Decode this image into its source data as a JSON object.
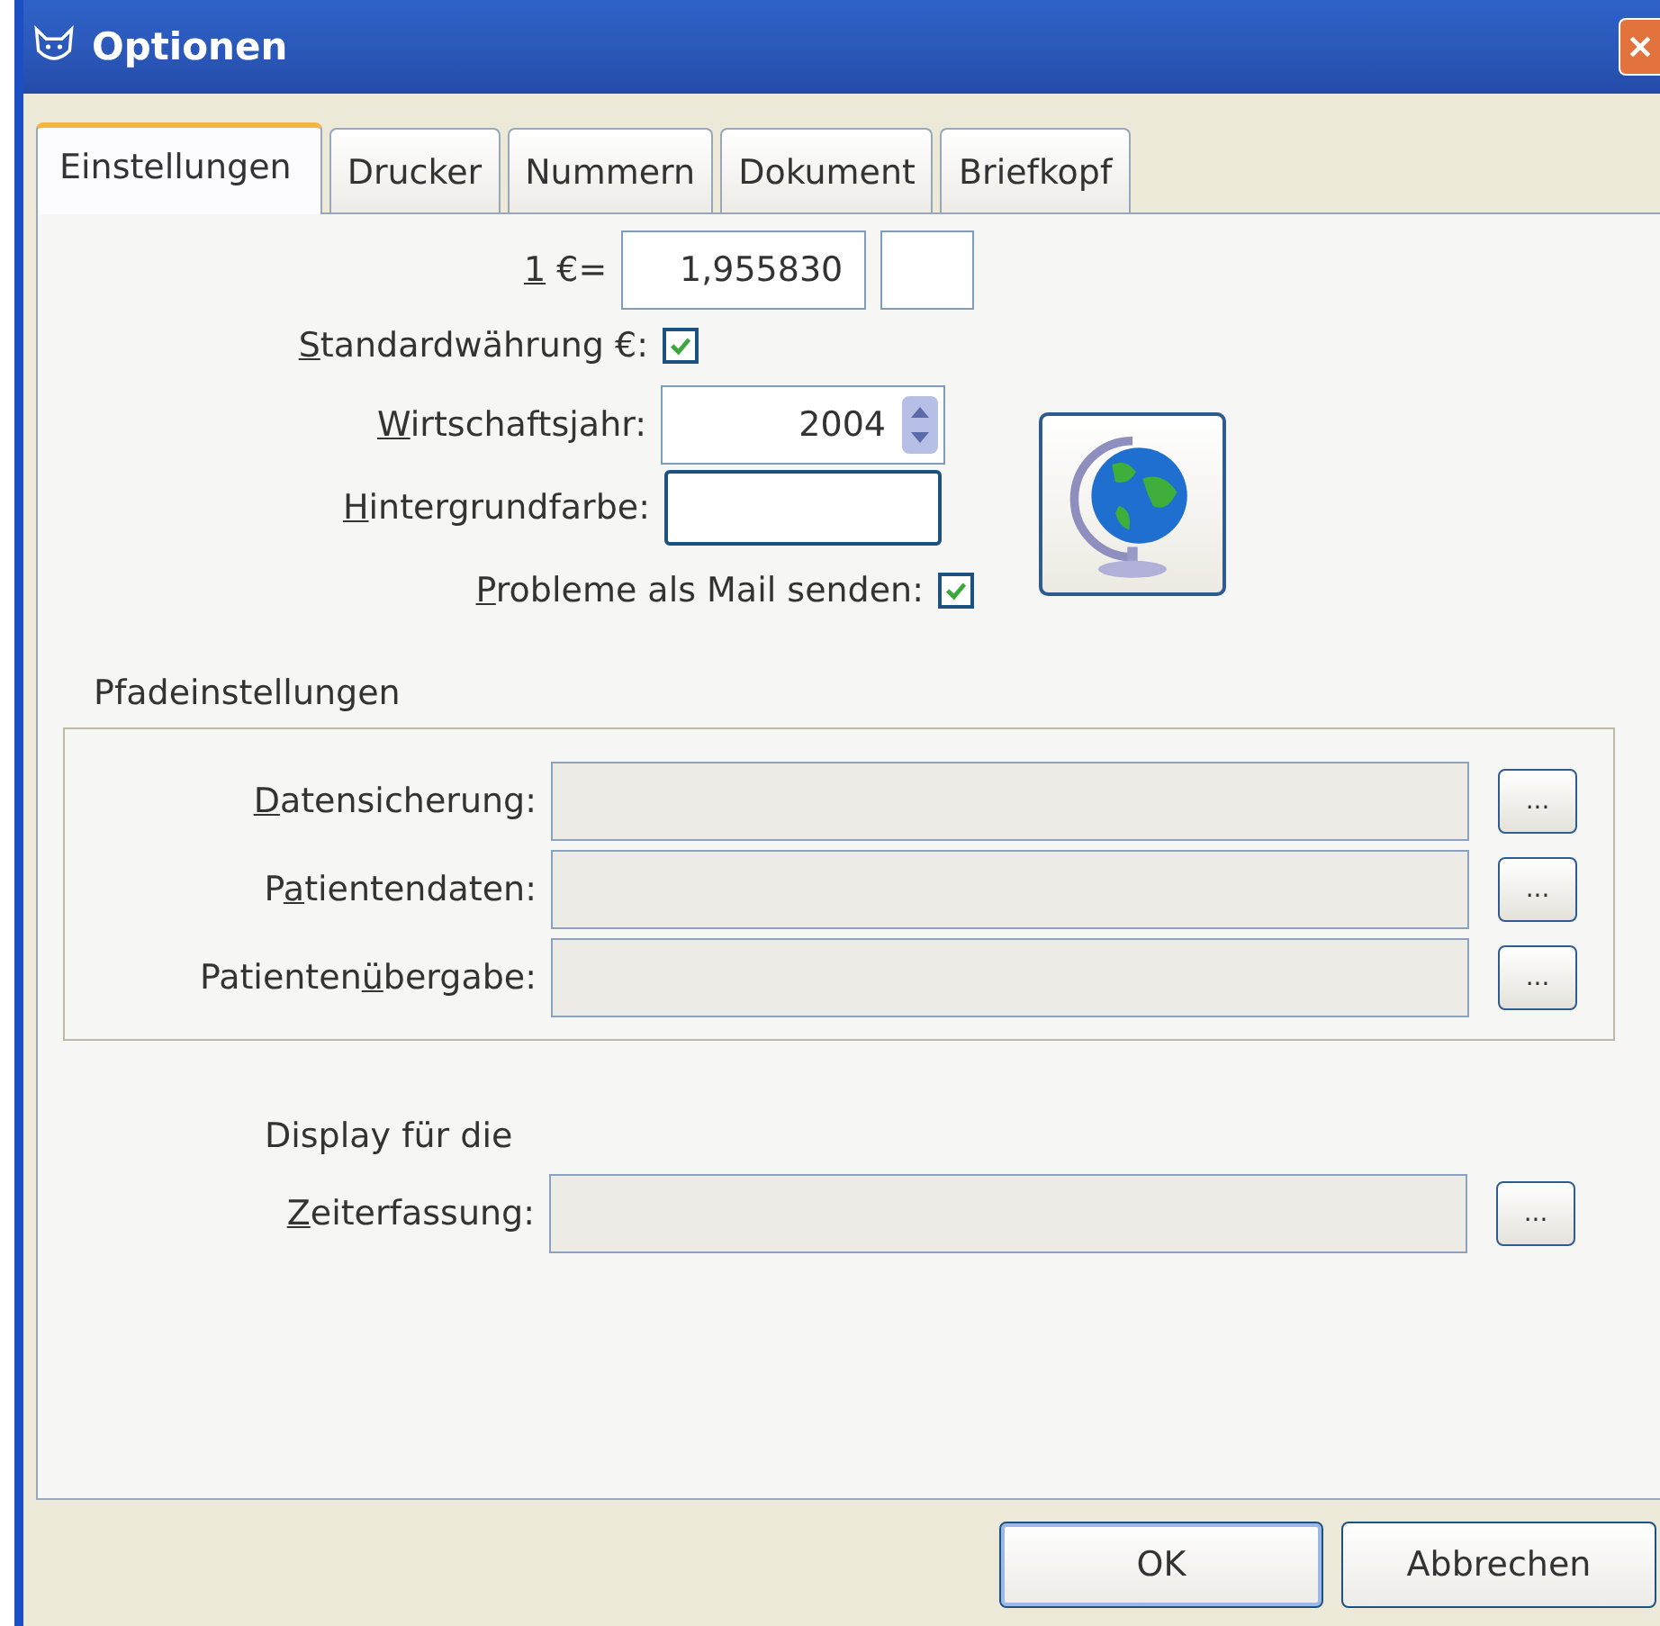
{
  "window": {
    "title": "Optionen"
  },
  "tabs": [
    {
      "label": "Einstellungen",
      "selected": true
    },
    {
      "label": "Drucker",
      "selected": false
    },
    {
      "label": "Nummern",
      "selected": false
    },
    {
      "label": "Dokument",
      "selected": false
    },
    {
      "label": "Briefkopf",
      "selected": false
    }
  ],
  "rate": {
    "label": [
      {
        "text": "1",
        "underlined": true
      },
      {
        "text": " €=",
        "underlined": false
      }
    ],
    "value": "1,955830"
  },
  "standard_currency": {
    "label": [
      {
        "text": "S",
        "underlined": true
      },
      {
        "text": "tandardwährung €:",
        "underlined": false
      }
    ],
    "checked": true
  },
  "fiscal_year": {
    "label": [
      {
        "text": "W",
        "underlined": true
      },
      {
        "text": "irtschaftsjahr:",
        "underlined": false
      }
    ],
    "value": "2004"
  },
  "background_color": {
    "label": [
      {
        "text": "H",
        "underlined": true
      },
      {
        "text": "intergrundfarbe:",
        "underlined": false
      }
    ]
  },
  "send_problems": {
    "label": [
      {
        "text": "P",
        "underlined": true
      },
      {
        "text": "robleme als Mail senden:",
        "underlined": false
      }
    ],
    "checked": true
  },
  "paths": {
    "title": "Pfadeinstellungen",
    "rows": [
      {
        "label": [
          {
            "text": "D",
            "underlined": true
          },
          {
            "text": "atensicherung:",
            "underlined": false
          }
        ],
        "button": "..."
      },
      {
        "label": [
          {
            "text": "P",
            "underlined": false
          },
          {
            "text": "a",
            "underlined": true
          },
          {
            "text": "tientendaten:",
            "underlined": false
          }
        ],
        "button": "..."
      },
      {
        "label": [
          {
            "text": "Patienten",
            "underlined": false
          },
          {
            "text": "ü",
            "underlined": true
          },
          {
            "text": "bergabe:",
            "underlined": false
          }
        ],
        "button": "..."
      }
    ]
  },
  "display": {
    "caption": "Display für die",
    "label": [
      {
        "text": "Z",
        "underlined": true
      },
      {
        "text": "eiterfassung:",
        "underlined": false
      }
    ],
    "button": "..."
  },
  "buttons": [
    "OK",
    "Abbrechen"
  ]
}
